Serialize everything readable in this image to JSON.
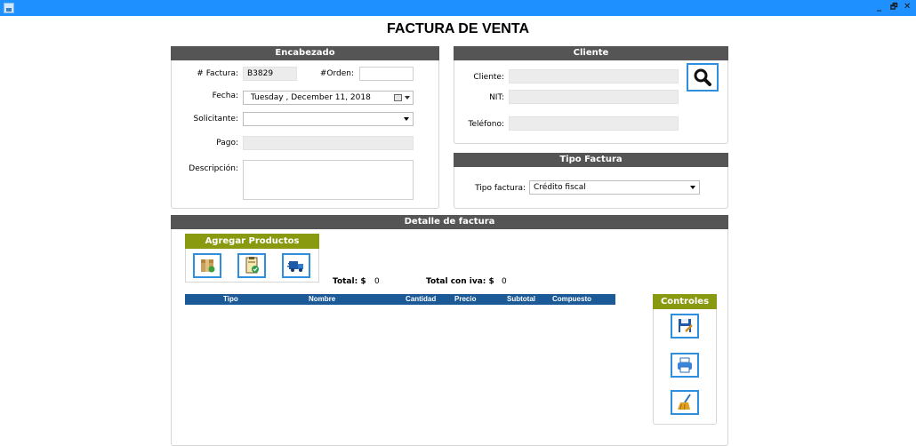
{
  "window": {
    "title": "",
    "buttons": {
      "minimize": "_",
      "restore": "🗗",
      "close": "✕"
    },
    "colors": {
      "titlebar": "#1e90ff",
      "panel_header": "#555555",
      "accent": "#8a9a10",
      "grid_header": "#1b5a96",
      "button_border": "#2e8fe0"
    }
  },
  "page_title": "FACTURA DE VENTA",
  "encabezado": {
    "header": "Encabezado",
    "factura_label": "# Factura:",
    "factura_value": "B3829",
    "orden_label": "#Orden:",
    "orden_value": "",
    "fecha_label": "Fecha:",
    "fecha_value": "Tuesday  , December 11, 2018",
    "solicitante_label": "Solicitante:",
    "solicitante_value": "",
    "pago_label": "Pago:",
    "pago_value": "",
    "descripcion_label": "Descripción:",
    "descripcion_value": ""
  },
  "cliente": {
    "header": "Cliente",
    "cliente_label": "Cliente:",
    "cliente_value": "",
    "nit_label": "NIT:",
    "nit_value": "",
    "telefono_label": "Teléfono:",
    "telefono_value": "",
    "search_icon": "search-icon"
  },
  "tipo_factura": {
    "header": "Tipo Factura",
    "label": "Tipo factura:",
    "value": "Crédito fiscal"
  },
  "detalle": {
    "header": "Detalle de factura",
    "agregar_header": "Agregar Productos",
    "add_buttons": [
      "package-icon",
      "checklist-icon",
      "truck-icon"
    ],
    "total_label": "Total: $",
    "total_value": "0",
    "total_iva_label": "Total con iva: $",
    "total_iva_value": "0",
    "columns": [
      "Tipo",
      "Nombre",
      "Cantidad",
      "Precio",
      "Subtotal",
      "Compuesto"
    ]
  },
  "controles": {
    "header": "Controles",
    "buttons": [
      "save-edit-icon",
      "printer-icon",
      "broom-icon"
    ]
  }
}
